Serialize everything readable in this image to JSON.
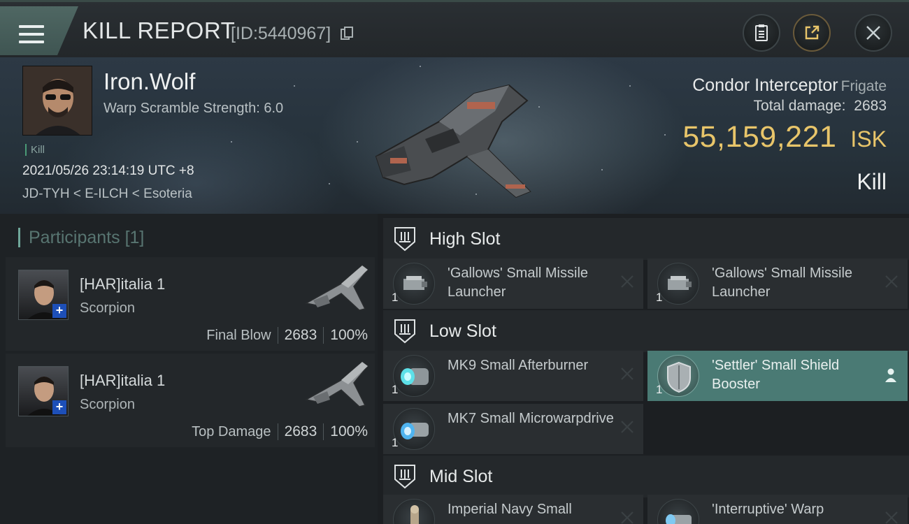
{
  "header": {
    "title": "KILL REPORT",
    "report_id": "[ID:5440967]"
  },
  "victim": {
    "name": "Iron.Wolf",
    "warp_info": "Warp Scramble Strength: 6.0",
    "tag": "Kill",
    "datetime": "2021/05/26 23:14:19 UTC +8",
    "location": "JD-TYH < E-ILCH < Esoteria",
    "ship_name": "Condor Interceptor",
    "ship_class": "Frigate",
    "total_damage_label": "Total damage:",
    "total_damage": "2683",
    "isk_value": "55,159,221",
    "isk_unit": "ISK",
    "result": "Kill"
  },
  "participants": {
    "label": "Participants",
    "count": "[1]",
    "items": [
      {
        "name": "[HAR]italia 1",
        "ship": "Scorpion",
        "role": "Final Blow",
        "damage": "2683",
        "percent": "100%"
      },
      {
        "name": "[HAR]italia 1",
        "ship": "Scorpion",
        "role": "Top Damage",
        "damage": "2683",
        "percent": "100%"
      }
    ]
  },
  "fitting": {
    "high_slot": {
      "title": "High Slot",
      "modules": [
        {
          "name": "'Gallows' Small Missile Launcher",
          "qty": "1"
        },
        {
          "name": "'Gallows' Small Missile Launcher",
          "qty": "1"
        }
      ]
    },
    "low_slot": {
      "title": "Low Slot",
      "modules": [
        {
          "name": "MK9 Small Afterburner",
          "qty": "1"
        },
        {
          "name": "'Settler' Small Shield Booster",
          "qty": "1"
        },
        {
          "name": "MK7 Small Microwarpdrive",
          "qty": "1"
        }
      ]
    },
    "mid_slot": {
      "title": "Mid Slot",
      "modules": [
        {
          "name": "Imperial Navy Small",
          "qty": ""
        },
        {
          "name": "'Interruptive' Warp",
          "qty": ""
        }
      ]
    }
  },
  "colors": {
    "accent": "#4a7a74",
    "isk": "#e8c56a",
    "badge": "#1d4fb8"
  },
  "icons": [
    "menu-icon",
    "copy-icon",
    "clipboard-icon",
    "share-icon",
    "close-icon",
    "slot-icon",
    "x-icon",
    "person-icon"
  ]
}
